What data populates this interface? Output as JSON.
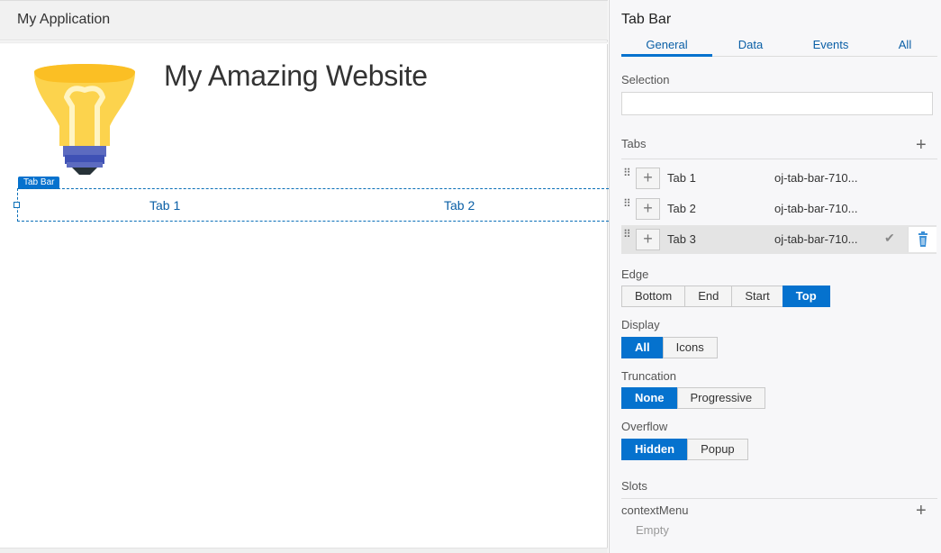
{
  "app": {
    "title": "My Application"
  },
  "site": {
    "title": "My Amazing Website"
  },
  "canvas_tabbar": {
    "badge": "Tab Bar",
    "tabs": [
      "Tab 1",
      "Tab 2"
    ]
  },
  "panel": {
    "title": "Tab Bar",
    "tabs": [
      "General",
      "Data",
      "Events",
      "All"
    ],
    "active_tab": "General",
    "selection_label": "Selection",
    "selection_value": "",
    "tabs_label": "Tabs",
    "tab_rows": [
      {
        "label": "Tab 1",
        "id": "oj-tab-bar-710..."
      },
      {
        "label": "Tab 2",
        "id": "oj-tab-bar-710..."
      },
      {
        "label": "Tab 3",
        "id": "oj-tab-bar-710..."
      }
    ],
    "edge": {
      "label": "Edge",
      "options": [
        "Bottom",
        "End",
        "Start",
        "Top"
      ],
      "selected": "Top"
    },
    "display": {
      "label": "Display",
      "options": [
        "All",
        "Icons"
      ],
      "selected": "All"
    },
    "truncation": {
      "label": "Truncation",
      "options": [
        "None",
        "Progressive"
      ],
      "selected": "None"
    },
    "overflow": {
      "label": "Overflow",
      "options": [
        "Hidden",
        "Popup"
      ],
      "selected": "Hidden"
    },
    "slots": {
      "label": "Slots",
      "name": "contextMenu",
      "empty": "Empty"
    }
  },
  "colors": {
    "accent": "#0572ce",
    "link": "#0a5fa6",
    "bulb_yellow": "#fbc02d",
    "bulb_base": "#5c6bc0"
  },
  "icons": {
    "add": "plus-icon",
    "drag": "drag-handle-icon",
    "check": "checkmark-icon",
    "delete": "trash-icon",
    "bulb": "lightbulb-icon"
  }
}
